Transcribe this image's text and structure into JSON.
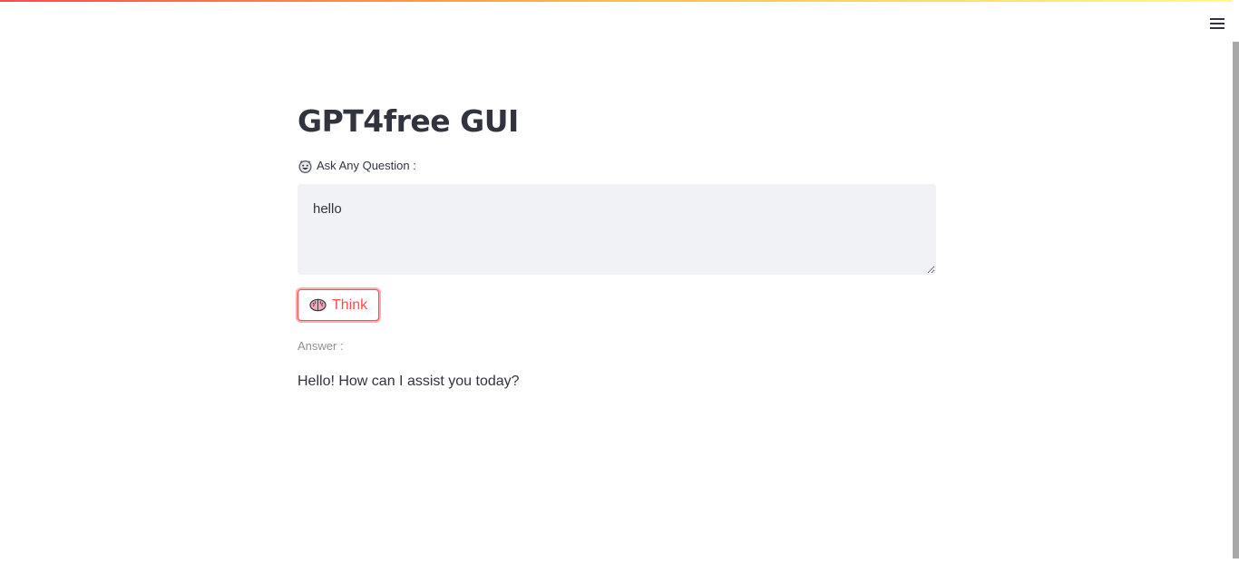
{
  "colors": {
    "accent": "#ff4b4b",
    "text": "#31333f",
    "muted_text": "#8e9096",
    "input_background": "#f0f2f6",
    "header_gradient": [
      "#ff4b4b",
      "#ffbd45",
      "#fffd80"
    ]
  },
  "header": {
    "menu_icon": "hamburger-menu-icon"
  },
  "main": {
    "title": "GPT4free GUI",
    "question_label": {
      "icon": "grinning-face-emoji-icon",
      "text": "Ask Any Question :"
    },
    "question_input": {
      "value": "hello"
    },
    "think_button": {
      "icon": "brain-emoji-icon",
      "label": "Think"
    },
    "answer_label": "Answer :",
    "answer_text": "Hello! How can I assist you today?"
  }
}
